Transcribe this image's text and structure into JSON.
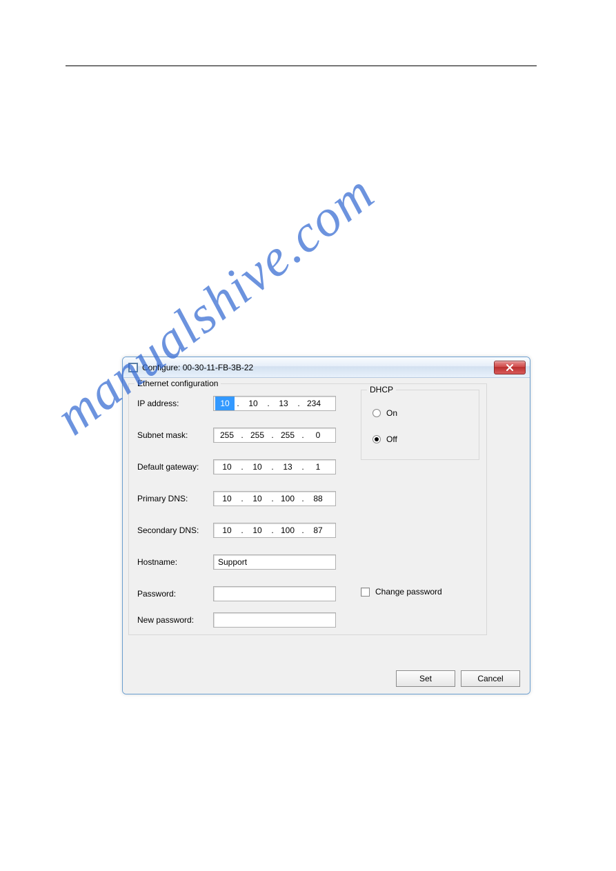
{
  "window": {
    "title": "Configure: 00-30-11-FB-3B-22"
  },
  "ethernet": {
    "legend": "Ethernet configuration",
    "ip_label": "IP address:",
    "ip": [
      "10",
      "10",
      "13",
      "234"
    ],
    "subnet_label": "Subnet mask:",
    "subnet": [
      "255",
      "255",
      "255",
      "0"
    ],
    "gateway_label": "Default gateway:",
    "gateway": [
      "10",
      "10",
      "13",
      "1"
    ],
    "pdns_label": "Primary DNS:",
    "pdns": [
      "10",
      "10",
      "100",
      "88"
    ],
    "sdns_label": "Secondary DNS:",
    "sdns": [
      "10",
      "10",
      "100",
      "87"
    ],
    "hostname_label": "Hostname:",
    "hostname": "Support",
    "password_label": "Password:",
    "password": "",
    "newpw_label": "New password:",
    "newpw": "",
    "changepw_label": "Change password"
  },
  "dhcp": {
    "legend": "DHCP",
    "on_label": "On",
    "off_label": "Off",
    "selected": "off"
  },
  "buttons": {
    "set": "Set",
    "cancel": "Cancel"
  },
  "watermark": "manualshive.com"
}
